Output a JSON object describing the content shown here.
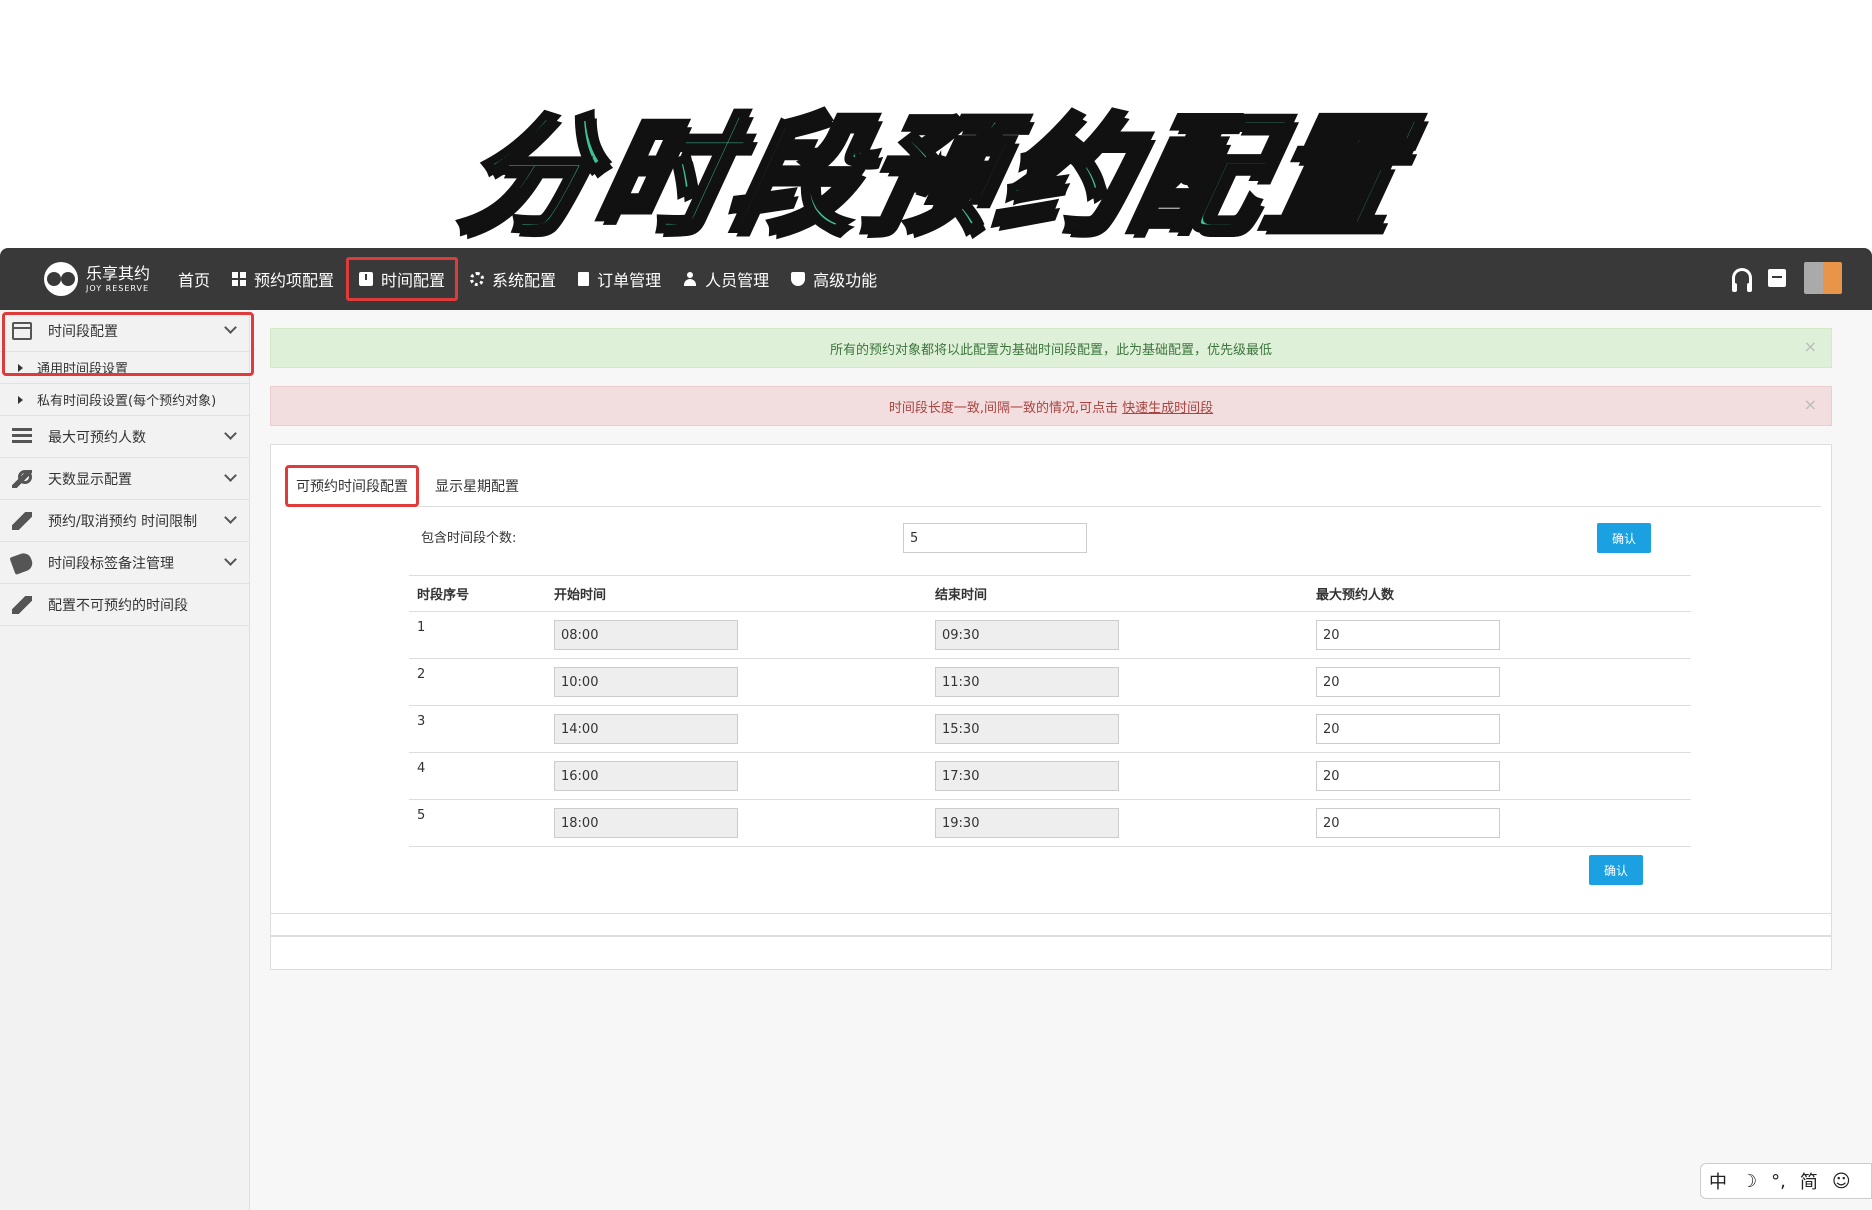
{
  "banner": {
    "title": "分时段预约配置"
  },
  "app": {
    "logo": {
      "cn": "乐享其约",
      "en": "JOY RESERVE"
    },
    "nav": [
      {
        "label": "首页",
        "icon": ""
      },
      {
        "label": "预约项配置",
        "icon": "grid-icon"
      },
      {
        "label": "时间配置",
        "icon": "clock-icon",
        "active": true
      },
      {
        "label": "系统配置",
        "icon": "gear-icon"
      },
      {
        "label": "订单管理",
        "icon": "document-icon"
      },
      {
        "label": "人员管理",
        "icon": "user-icon"
      },
      {
        "label": "高级功能",
        "icon": "shield-icon"
      }
    ],
    "top_right_icons": [
      "headset-icon",
      "archive-icon",
      "avatar"
    ]
  },
  "sidebar": {
    "items": [
      {
        "label": "时间段配置",
        "icon": "calendar-icon",
        "expanded": true
      },
      {
        "label": "通用时间段设置",
        "sub": true
      },
      {
        "label": "私有时间段设置(每个预约对象)",
        "sub": true
      },
      {
        "label": "最大可预约人数",
        "icon": "list-icon"
      },
      {
        "label": "天数显示配置",
        "icon": "wrench-icon"
      },
      {
        "label": "预约/取消预约 时间限制",
        "icon": "pencil-icon"
      },
      {
        "label": "时间段标签备注管理",
        "icon": "tags-icon"
      },
      {
        "label": "配置不可预约的时间段",
        "icon": "pencil-icon"
      }
    ]
  },
  "alerts": {
    "info": "所有的预约对象都将以此配置为基础时间段配置，此为基础配置，优先级最低",
    "warning_text": "时间段长度一致,间隔一致的情况,可点击",
    "warning_link": "快速生成时间段",
    "close": "×"
  },
  "tabs": [
    "可预约时间段配置",
    "显示星期配置"
  ],
  "form": {
    "count_label": "包含时间段个数:",
    "count_value": "5",
    "confirm_label": "确认"
  },
  "table": {
    "headers": [
      "时段序号",
      "开始时间",
      "结束时间",
      "最大预约人数"
    ],
    "rows": [
      {
        "index": "1",
        "start": "08:00",
        "end": "09:30",
        "max": "20"
      },
      {
        "index": "2",
        "start": "10:00",
        "end": "11:30",
        "max": "20"
      },
      {
        "index": "3",
        "start": "14:00",
        "end": "15:30",
        "max": "20"
      },
      {
        "index": "4",
        "start": "16:00",
        "end": "17:30",
        "max": "20"
      },
      {
        "index": "5",
        "start": "18:00",
        "end": "19:30",
        "max": "20"
      }
    ]
  },
  "ime": [
    "中",
    "☽",
    "°,",
    "简",
    "☺"
  ]
}
